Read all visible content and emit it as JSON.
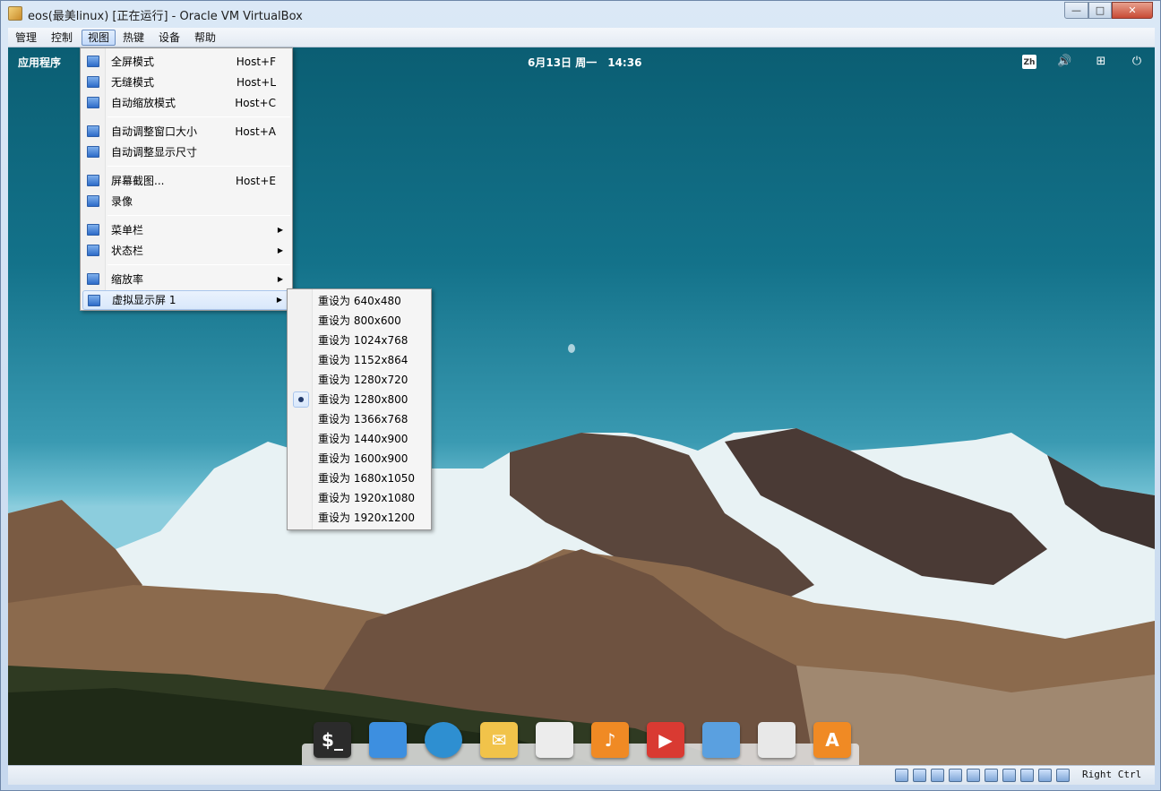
{
  "window": {
    "title": "eos(最美linux) [正在运行] - Oracle VM VirtualBox",
    "controls": {
      "minimize": "—",
      "maximize": "□",
      "close": "✕"
    }
  },
  "menubar": {
    "items": [
      {
        "label": "管理"
      },
      {
        "label": "控制"
      },
      {
        "label": "视图"
      },
      {
        "label": "热键"
      },
      {
        "label": "设备"
      },
      {
        "label": "帮助"
      }
    ],
    "active": "视图"
  },
  "view_menu": {
    "items": [
      {
        "label": "全屏模式",
        "shortcut": "Host+F",
        "icon": "fullscreen-icon"
      },
      {
        "label": "无缝模式",
        "shortcut": "Host+L",
        "icon": "seamless-icon"
      },
      {
        "label": "自动缩放模式",
        "shortcut": "Host+C",
        "icon": "scale-icon"
      },
      {
        "label": "自动调整窗口大小",
        "shortcut": "Host+A",
        "icon": "adjust-window-icon"
      },
      {
        "label": "自动调整显示尺寸",
        "shortcut": "",
        "icon": "adjust-display-icon"
      },
      {
        "label": "屏幕截图...",
        "shortcut": "Host+E",
        "icon": "screenshot-icon"
      },
      {
        "label": "录像",
        "shortcut": "",
        "icon": "recording-icon"
      },
      {
        "label": "菜单栏",
        "shortcut": "",
        "icon": "menubar-icon",
        "submenu": true
      },
      {
        "label": "状态栏",
        "shortcut": "",
        "icon": "statusbar-icon",
        "submenu": true
      },
      {
        "label": "缩放率",
        "shortcut": "",
        "icon": "scale-factor-icon",
        "submenu": true
      },
      {
        "label": "虚拟显示屏 1",
        "shortcut": "",
        "icon": "virtual-screen-icon",
        "submenu": true
      }
    ]
  },
  "resize_menu": {
    "items": [
      "重设为 640x480",
      "重设为 800x600",
      "重设为 1024x768",
      "重设为 1152x864",
      "重设为 1280x720",
      "重设为 1280x800",
      "重设为 1366x768",
      "重设为 1440x900",
      "重设为 1600x900",
      "重设为 1680x1050",
      "重设为 1920x1080",
      "重设为 1920x1200"
    ],
    "selected": "重设为 1280x800"
  },
  "guest": {
    "apps_label": "应用程序",
    "clock": "6月13日 周一　14:36",
    "tray": {
      "lang": "Zh",
      "volume_icon": "volume-icon",
      "network_icon": "network-icon",
      "power_icon": "power-icon"
    },
    "dock": [
      {
        "name": "terminal",
        "color": "#2b2b2b",
        "glyph": "$_"
      },
      {
        "name": "multitasking",
        "color": "#3d8fe0",
        "glyph": ""
      },
      {
        "name": "browser",
        "color": "#2e8fd1",
        "glyph": ""
      },
      {
        "name": "mail",
        "color": "#f1c34a",
        "glyph": "✉"
      },
      {
        "name": "calendar",
        "color": "#ececec",
        "glyph": ""
      },
      {
        "name": "music",
        "color": "#f08a24",
        "glyph": "♪"
      },
      {
        "name": "videos",
        "color": "#d93a32",
        "glyph": "▶"
      },
      {
        "name": "photos",
        "color": "#5aa0e0",
        "glyph": ""
      },
      {
        "name": "settings",
        "color": "#e8e8e8",
        "glyph": ""
      },
      {
        "name": "appcenter",
        "color": "#f08a24",
        "glyph": "A"
      }
    ]
  },
  "statusbar": {
    "host_key": "Right Ctrl",
    "icons": [
      "hdd-icon",
      "optical-icon",
      "network-adapter-icon",
      "usb-icon",
      "shared-folder-icon",
      "display-icon",
      "video-capture-icon",
      "cpu-icon",
      "mouse-integration-icon",
      "keyboard-icon"
    ]
  },
  "colors": {
    "sky_top": "#0b5e73",
    "accent": "#3399ff",
    "menu_highlight": "#d9e8fb"
  }
}
